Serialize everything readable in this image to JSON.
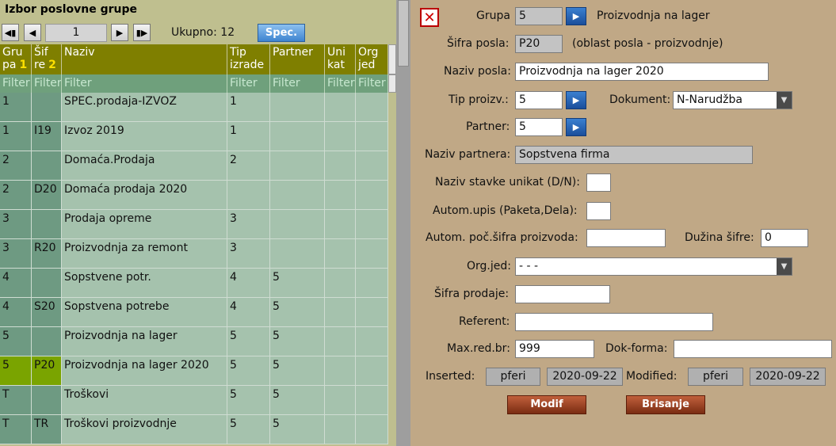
{
  "left": {
    "title": "Izbor poslovne grupe",
    "pager": {
      "first_icon": "first-page-icon",
      "prev_icon": "prev-page-icon",
      "next_icon": "next-page-icon",
      "last_icon": "last-page-icon",
      "page": "1",
      "total": "Ukupno: 12",
      "spec_label": "Spec."
    },
    "headers": [
      {
        "line1": "Gru",
        "line2": "pa",
        "sort": "1"
      },
      {
        "line1": "Šif",
        "line2": "re",
        "sort": "2"
      },
      {
        "line1": "Naziv",
        "line2": "",
        "sort": ""
      },
      {
        "line1": "Tip",
        "line2": "izrade",
        "sort": ""
      },
      {
        "line1": "Partner",
        "line2": "",
        "sort": ""
      },
      {
        "line1": "Uni",
        "line2": "kat",
        "sort": ""
      },
      {
        "line1": "Org",
        "line2": "jed",
        "sort": ""
      }
    ],
    "filter_label": "Filter",
    "rows": [
      [
        "1",
        "",
        "SPEC.prodaja-IZVOZ",
        "1",
        "",
        "",
        ""
      ],
      [
        "1",
        "I19",
        "Izvoz 2019",
        "1",
        "",
        "",
        ""
      ],
      [
        "2",
        "",
        "Domaća.Prodaja",
        "2",
        "",
        "",
        ""
      ],
      [
        "2",
        "D20",
        "Domaća prodaja 2020",
        "",
        "",
        "",
        ""
      ],
      [
        "3",
        "",
        "Prodaja opreme",
        "3",
        "",
        "",
        ""
      ],
      [
        "3",
        "R20",
        "Proizvodnja za remont",
        "3",
        "",
        "",
        ""
      ],
      [
        "4",
        "",
        "Sopstvene potr.",
        "4",
        "5",
        "",
        ""
      ],
      [
        "4",
        "S20",
        "Sopstvena potrebe",
        "4",
        "5",
        "",
        ""
      ],
      [
        "5",
        "",
        "Proizvodnja na lager",
        "5",
        "5",
        "",
        ""
      ],
      [
        "5",
        "P20",
        "Proizvodnja na lager 2020",
        "5",
        "5",
        "",
        ""
      ],
      [
        "T",
        "",
        "Troškovi",
        "5",
        "5",
        "",
        ""
      ],
      [
        "T",
        "TR",
        "Troškovi proizvodnje",
        "5",
        "5",
        "",
        ""
      ]
    ],
    "selected_row": 9
  },
  "form": {
    "close_icon": "close-icon",
    "grupa_label": "Grupa",
    "grupa_value": "5",
    "grupa_name": "Proizvodnja na lager",
    "sifra_label": "Šifra posla:",
    "sifra_value": "P20",
    "sifra_note": "(oblast posla - proizvodnje)",
    "naziv_label": "Naziv posla:",
    "naziv_value": "Proizvodnja na lager 2020",
    "tip_label": "Tip proizv.:",
    "tip_value": "5",
    "dokument_label": "Dokument:",
    "dokument_value": "N-Narudžba",
    "partner_label": "Partner:",
    "partner_value": "5",
    "naziv_partnera_label": "Naziv partnera:",
    "naziv_partnera_value": "Sopstvena firma",
    "unikat_label": "Naziv stavke unikat (D/N):",
    "unikat_value": "",
    "autom_label": "Autom.upis (Paketa,Dela):",
    "autom_value": "",
    "poc_label": "Autom. poč.šifra proizvoda:",
    "poc_value": "",
    "duzina_label": "Dužina šifre:",
    "duzina_value": "0",
    "orgjed_label": "Org.jed:",
    "orgjed_value": "- - -",
    "sifra_prodaje_label": "Šifra prodaje:",
    "sifra_prodaje_value": "",
    "referent_label": "Referent:",
    "referent_value": "",
    "maxred_label": "Max.red.br:",
    "maxred_value": "999",
    "dokforma_label": "Dok-forma:",
    "dokforma_value": "",
    "inserted_label": "Inserted:",
    "inserted_user": "pferi",
    "inserted_date": "2020-09-22",
    "modified_label": "Modified:",
    "modified_user": "pferi",
    "modified_date": "2020-09-22",
    "modif_btn": "Modif",
    "brisanje_btn": "Brisanje"
  }
}
